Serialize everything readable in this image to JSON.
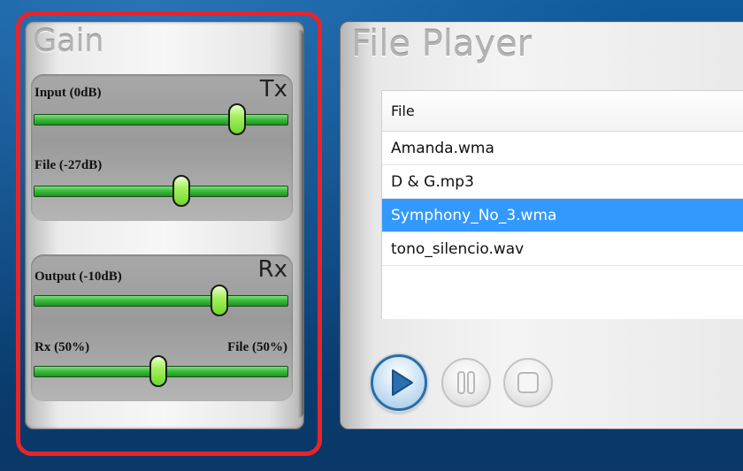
{
  "gain": {
    "title": "Gain",
    "tx": {
      "title": "Tx",
      "input": {
        "label": "Input (0dB)",
        "level": 0.8
      },
      "file": {
        "label": "File (-27dB)",
        "level": 0.58
      }
    },
    "rx": {
      "title": "Rx",
      "output": {
        "label": "Output (-10dB)",
        "level": 0.73
      },
      "mix": {
        "left_label": "Rx (50%)",
        "right_label": "File (50%)",
        "level": 0.49
      }
    }
  },
  "player": {
    "title": "File Player",
    "column_header": "File",
    "files": [
      "Amanda.wma",
      "D & G.mp3",
      "Symphony_No_3.wma",
      "tono_silencio.wav"
    ],
    "selected_file": "Symphony_No_3.wma",
    "controls": [
      "play-icon",
      "pause-icon",
      "stop-icon"
    ]
  },
  "colors": {
    "accent": "#3399ff",
    "slider_green": "#38b838",
    "highlight_border": "#e8242b",
    "desktop_blue": "#0c4d8a"
  }
}
